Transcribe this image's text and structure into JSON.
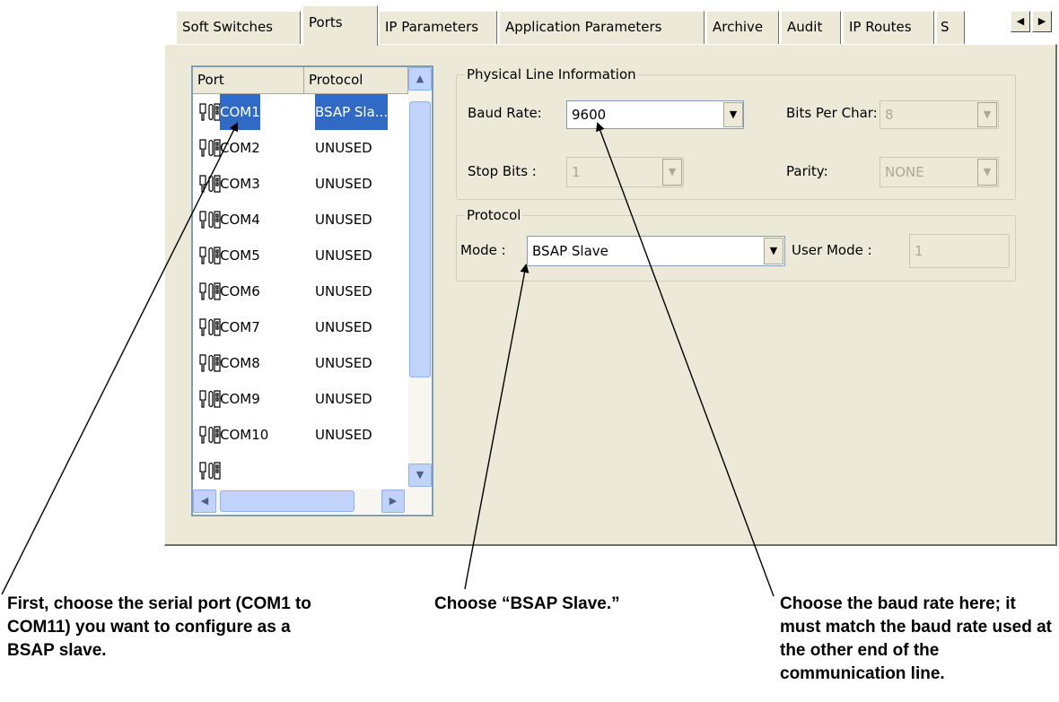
{
  "tabs": [
    {
      "label": "Soft Switches"
    },
    {
      "label": "Ports",
      "active": true
    },
    {
      "label": "IP Parameters"
    },
    {
      "label": "Application Parameters"
    },
    {
      "label": "Archive"
    },
    {
      "label": "Audit"
    },
    {
      "label": "IP Routes"
    },
    {
      "label": "S"
    }
  ],
  "port_list": {
    "columns": [
      "Port",
      "Protocol"
    ],
    "rows": [
      {
        "port": "COM1",
        "protocol": "BSAP Sla...",
        "selected": true
      },
      {
        "port": "COM2",
        "protocol": "UNUSED"
      },
      {
        "port": "COM3",
        "protocol": "UNUSED"
      },
      {
        "port": "COM4",
        "protocol": "UNUSED"
      },
      {
        "port": "COM5",
        "protocol": "UNUSED"
      },
      {
        "port": "COM6",
        "protocol": "UNUSED"
      },
      {
        "port": "COM7",
        "protocol": "UNUSED"
      },
      {
        "port": "COM8",
        "protocol": "UNUSED"
      },
      {
        "port": "COM9",
        "protocol": "UNUSED"
      },
      {
        "port": "COM10",
        "protocol": "UNUSED"
      }
    ]
  },
  "physical": {
    "legend": "Physical Line Information",
    "baud_label": "Baud Rate:",
    "baud_value": "9600",
    "bits_label": "Bits Per Char:",
    "bits_value": "8",
    "stop_label": "Stop Bits :",
    "stop_value": "1",
    "parity_label": "Parity:",
    "parity_value": "NONE"
  },
  "protocol": {
    "legend": "Protocol",
    "mode_label": "Mode :",
    "mode_value": "BSAP Slave",
    "user_mode_label": "User Mode :",
    "user_mode_value": "1"
  },
  "annotations": {
    "port_note": "First, choose the serial port (COM1 to COM11) you want to configure as a BSAP slave.",
    "mode_note": "Choose “BSAP Slave.”",
    "baud_note": "Choose the baud rate here; it must match the baud rate used at the other end of the communication line."
  },
  "colors": {
    "selection": "#316ac5",
    "panel": "#ece9d8"
  }
}
